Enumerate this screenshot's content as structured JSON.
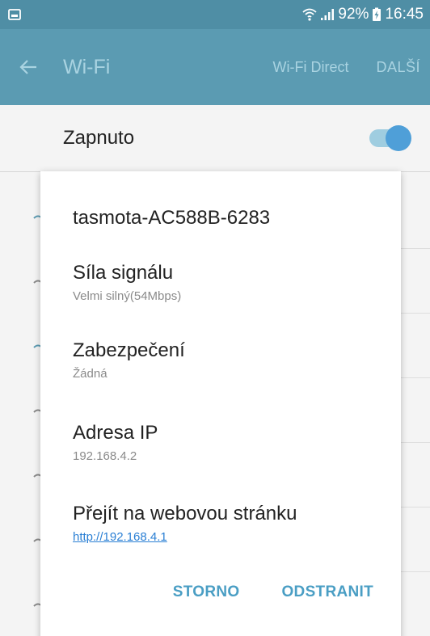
{
  "status_bar": {
    "battery_percent": "92%",
    "time": "16:45",
    "left_icon": "gallery-icon",
    "icons": [
      "wifi-icon",
      "signal-icon",
      "battery-charging-icon"
    ]
  },
  "app_bar": {
    "title": "Wi-Fi",
    "back_icon": "arrow-left-icon",
    "actions": {
      "wifi_direct": "Wi-Fi Direct",
      "more": "DALŠÍ"
    }
  },
  "toggle": {
    "label": "Zapnuto",
    "checked": true
  },
  "dialog": {
    "title": "tasmota-AC588B-6283",
    "details": {
      "signal": {
        "label": "Síla signálu",
        "value": "Velmi silný(54Mbps)"
      },
      "security": {
        "label": "Zabezpečení",
        "value": "Žádná"
      },
      "ip": {
        "label": "Adresa IP",
        "value": "192.168.4.2"
      },
      "web": {
        "label": "Přejít na webovou stránku",
        "link": "http://192.168.4.1"
      }
    },
    "buttons": {
      "cancel": "STORNO",
      "forget": "ODSTRANIT"
    }
  },
  "colors": {
    "status_bar": "#4f8ea5",
    "app_bar": "#5b9bb2",
    "accent": "#4a9ec4",
    "link": "#2a7fd4"
  }
}
